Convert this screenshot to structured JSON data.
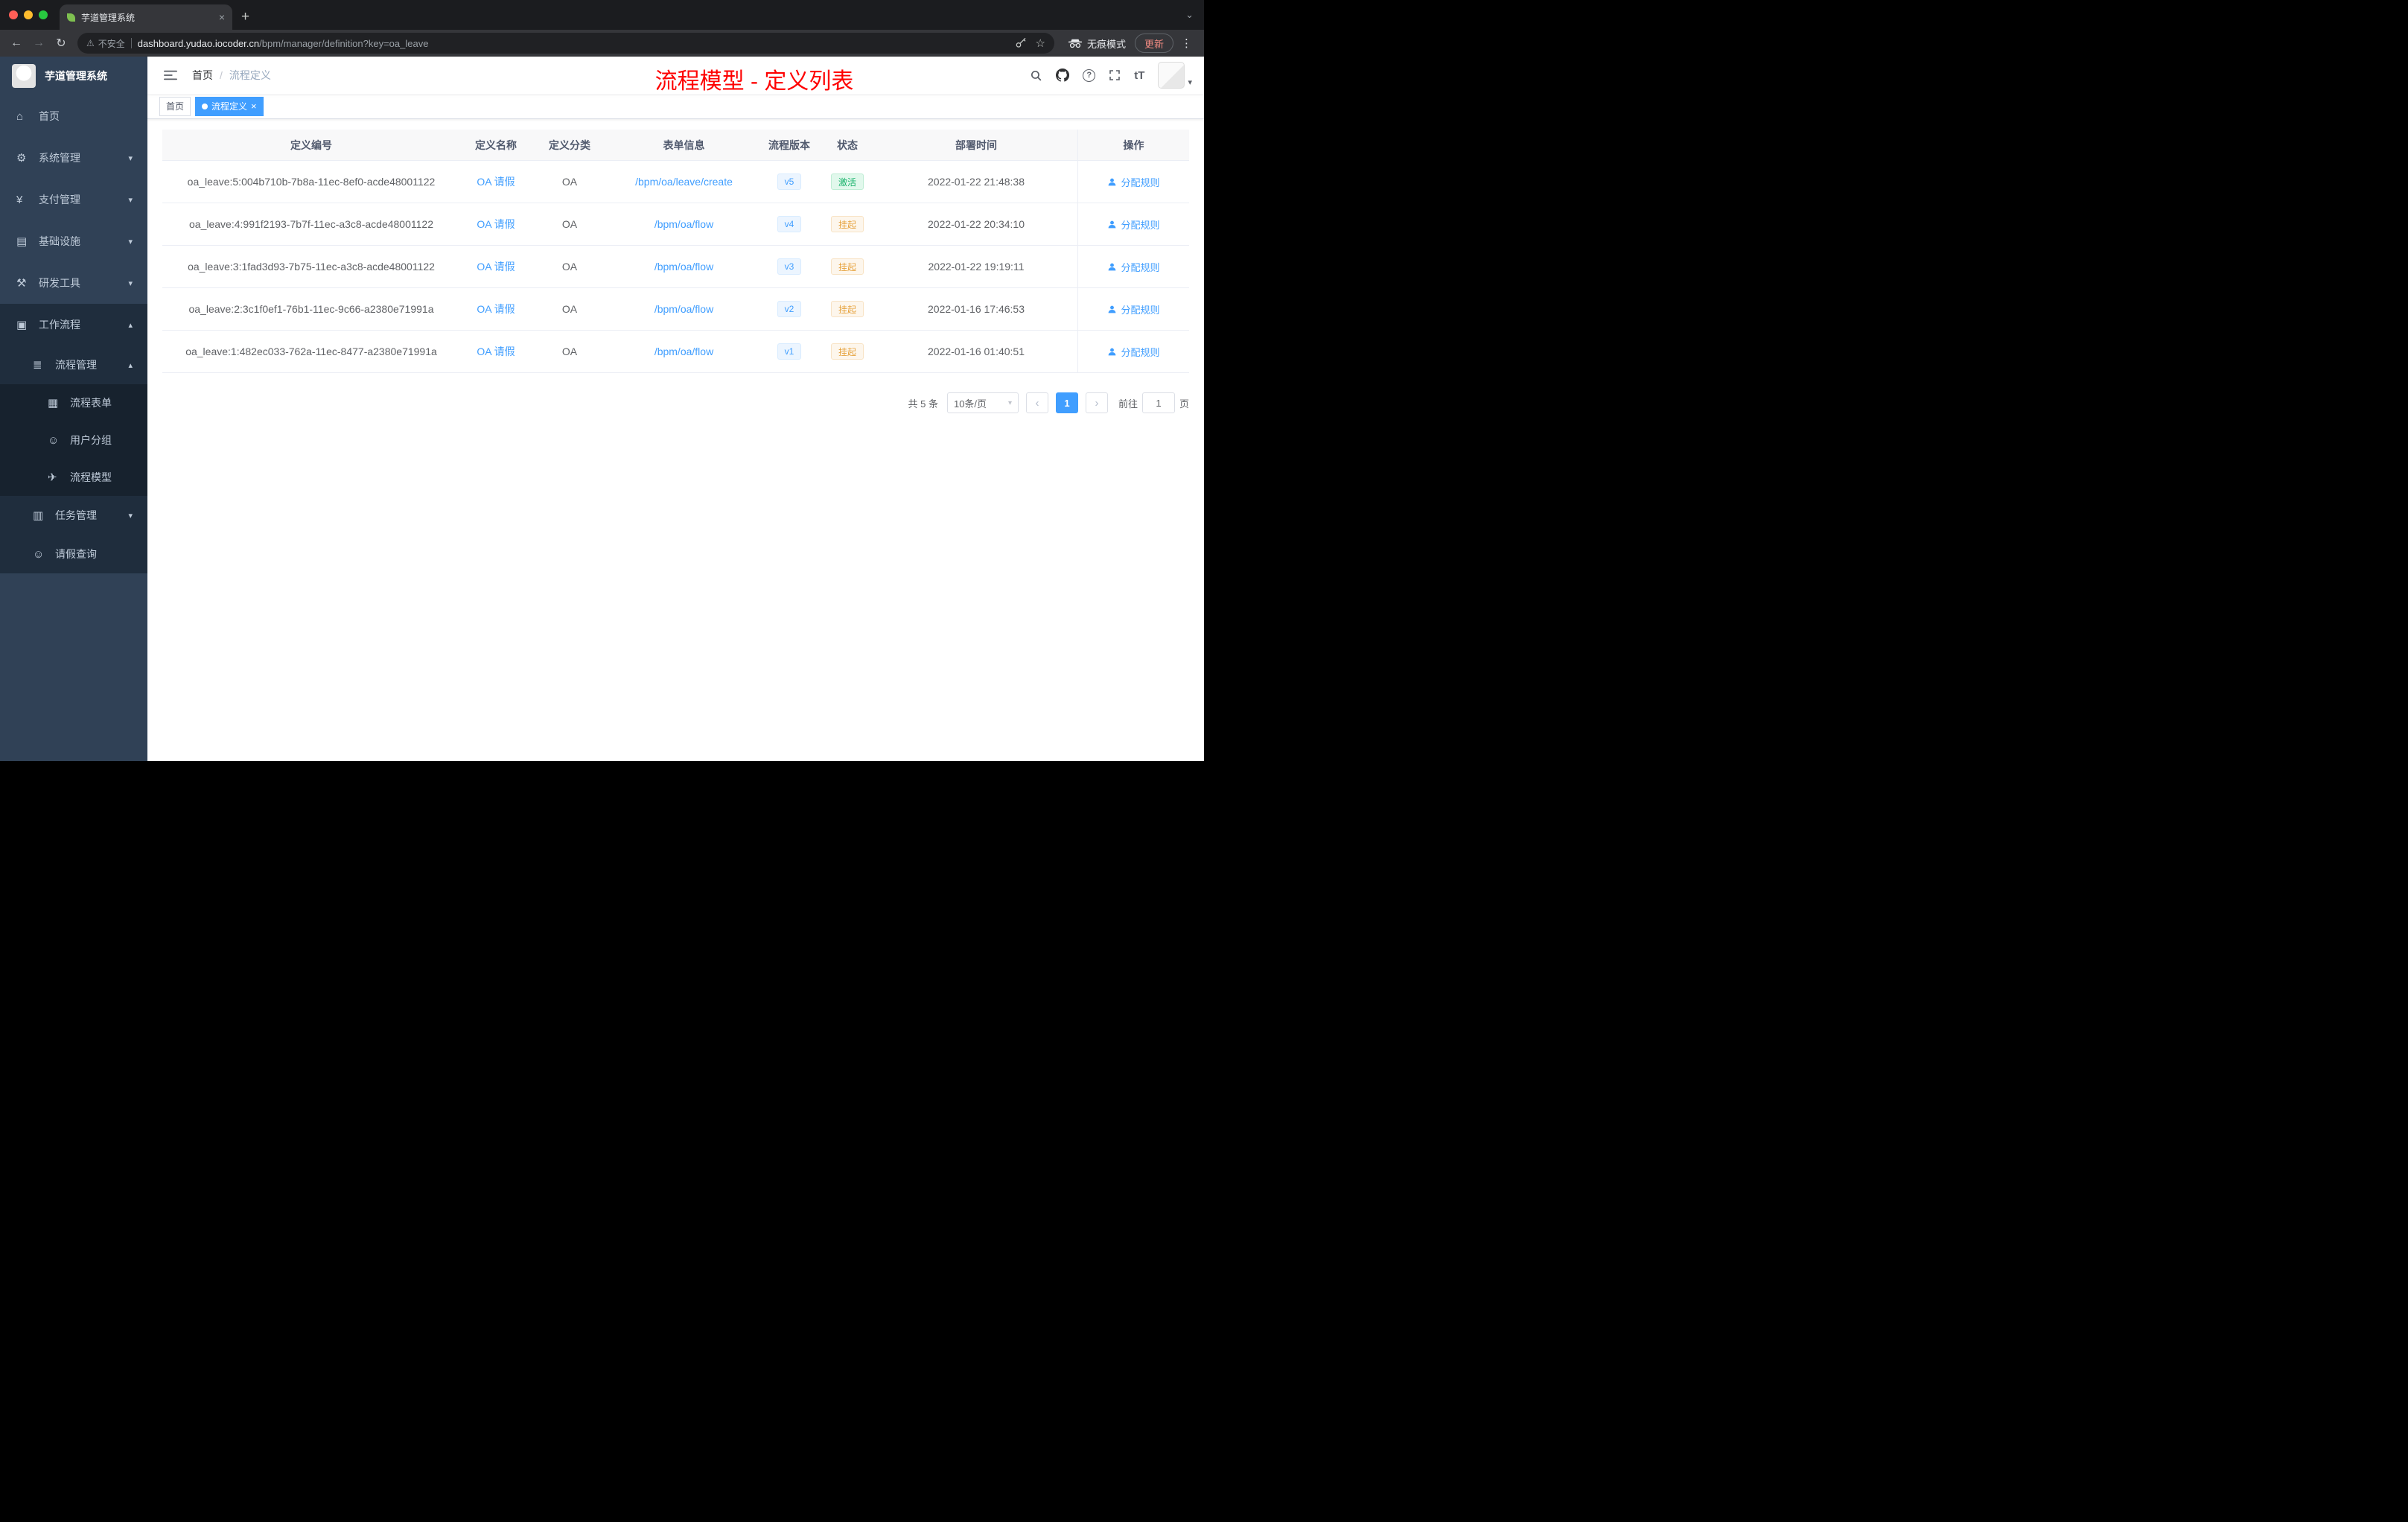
{
  "browser": {
    "tab_title": "芋道管理系统",
    "security_label": "不安全",
    "url_host": "dashboard.yudao.iocoder.cn",
    "url_path": "/bpm/manager/definition?key=oa_leave",
    "incognito_label": "无痕模式",
    "update_label": "更新"
  },
  "sidebar": {
    "logo_title": "芋道管理系统",
    "menu": [
      {
        "label": "首页",
        "icon": "dashboard-icon",
        "glyph": "⌂"
      },
      {
        "label": "系统管理",
        "icon": "gear-icon",
        "glyph": "⚙"
      },
      {
        "label": "支付管理",
        "icon": "payment-icon",
        "glyph": "¥"
      },
      {
        "label": "基础设施",
        "icon": "infrastructure-icon",
        "glyph": "▤"
      },
      {
        "label": "研发工具",
        "icon": "dev-tools-icon",
        "glyph": "⚒"
      },
      {
        "label": "工作流程",
        "icon": "workflow-icon",
        "glyph": "▣"
      }
    ],
    "submenu": {
      "process_mgmt_label": "流程管理",
      "process_mgmt_glyph": "≣",
      "children": [
        {
          "label": "流程表单",
          "icon": "form-icon",
          "glyph": "▦"
        },
        {
          "label": "用户分组",
          "icon": "user-group-icon",
          "glyph": "☺"
        },
        {
          "label": "流程模型",
          "icon": "paper-plane-icon",
          "glyph": "✈"
        }
      ],
      "task_mgmt_label": "任务管理",
      "task_mgmt_glyph": "▥",
      "leave_query_label": "请假查询",
      "leave_query_glyph": "☺"
    }
  },
  "header": {
    "breadcrumb_home": "首页",
    "breadcrumb_sep": "/",
    "breadcrumb_current": "流程定义",
    "annotation": "流程模型 - 定义列表",
    "font_icon_label": "tT"
  },
  "tags": {
    "first": "首页",
    "active": "流程定义"
  },
  "table": {
    "columns": [
      "定义编号",
      "定义名称",
      "定义分类",
      "表单信息",
      "流程版本",
      "状态",
      "部署时间",
      "操作"
    ],
    "rows": [
      {
        "id": "oa_leave:5:004b710b-7b8a-11ec-8ef0-acde48001122",
        "name": "OA 请假",
        "category": "OA",
        "form": "/bpm/oa/leave/create",
        "version": "v5",
        "status": "激活",
        "time": "2022-01-22 21:48:38",
        "action": "分配规则"
      },
      {
        "id": "oa_leave:4:991f2193-7b7f-11ec-a3c8-acde48001122",
        "name": "OA 请假",
        "category": "OA",
        "form": "/bpm/oa/flow",
        "version": "v4",
        "status": "挂起",
        "time": "2022-01-22 20:34:10",
        "action": "分配规则"
      },
      {
        "id": "oa_leave:3:1fad3d93-7b75-11ec-a3c8-acde48001122",
        "name": "OA 请假",
        "category": "OA",
        "form": "/bpm/oa/flow",
        "version": "v3",
        "status": "挂起",
        "time": "2022-01-22 19:19:11",
        "action": "分配规则"
      },
      {
        "id": "oa_leave:2:3c1f0ef1-76b1-11ec-9c66-a2380e71991a",
        "name": "OA 请假",
        "category": "OA",
        "form": "/bpm/oa/flow",
        "version": "v2",
        "status": "挂起",
        "time": "2022-01-16 17:46:53",
        "action": "分配规则"
      },
      {
        "id": "oa_leave:1:482ec033-762a-11ec-8477-a2380e71991a",
        "name": "OA 请假",
        "category": "OA",
        "form": "/bpm/oa/flow",
        "version": "v1",
        "status": "挂起",
        "time": "2022-01-16 01:40:51",
        "action": "分配规则"
      }
    ]
  },
  "pagination": {
    "total": "共 5 条",
    "page_size": "10条/页",
    "current_page": "1",
    "goto_label": "前往",
    "goto_value": "1",
    "unit_label": "页"
  },
  "colors": {
    "accent": "#409eff",
    "success": "#17b26a",
    "warning": "#e6a23c",
    "annotation_red": "#fe0000",
    "sidebar_bg": "#304156",
    "submenu_bg": "#1f2d3d"
  }
}
